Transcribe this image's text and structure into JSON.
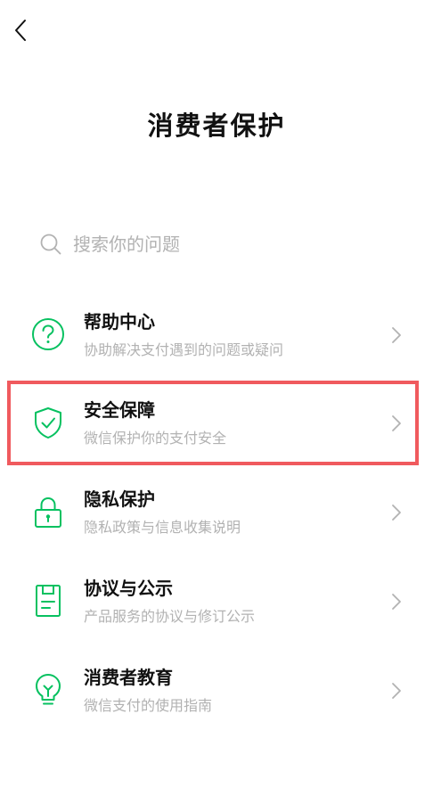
{
  "header": {
    "back_icon": "chevron-left-icon",
    "title": "消费者保护"
  },
  "search": {
    "icon": "search-icon",
    "placeholder": "搜索你的问题",
    "value": ""
  },
  "colors": {
    "accent": "#07c160",
    "highlight": "#f05a5e",
    "secondary_text": "#b2b2b2"
  },
  "menu": {
    "items": [
      {
        "icon": "question-circle-icon",
        "title": "帮助中心",
        "desc": "协助解决支付遇到的问题或疑问"
      },
      {
        "icon": "shield-check-icon",
        "title": "安全保障",
        "desc": "微信保护你的支付安全",
        "highlighted": true
      },
      {
        "icon": "lock-icon",
        "title": "隐私保护",
        "desc": "隐私政策与信息收集说明"
      },
      {
        "icon": "document-icon",
        "title": "协议与公示",
        "desc": "产品服务的协议与修订公示"
      },
      {
        "icon": "lightbulb-icon",
        "title": "消费者教育",
        "desc": "微信支付的使用指南"
      }
    ]
  }
}
